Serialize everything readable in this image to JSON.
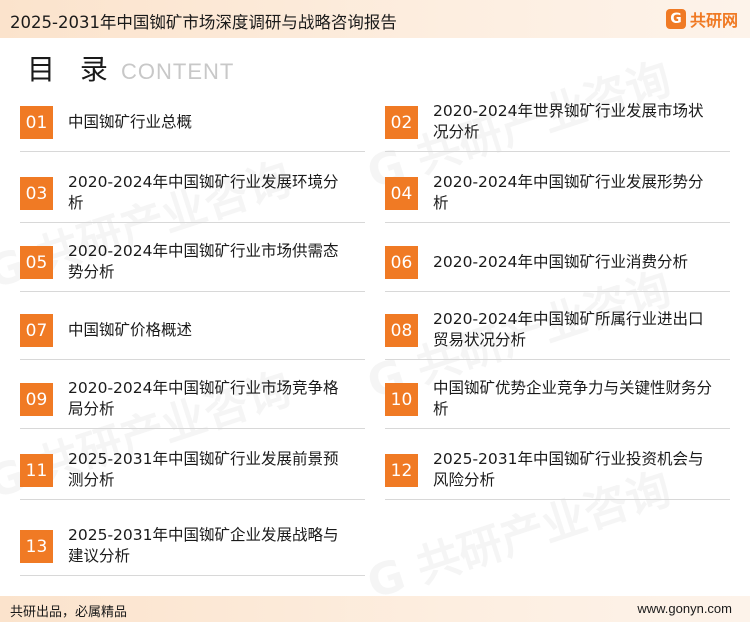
{
  "header": {
    "title": "2025-2031年中国铷矿市场深度调研与战略咨询报告",
    "logo_text": "共研网",
    "logo_mark": "G"
  },
  "toc": {
    "title_cn": "目 录",
    "title_en": "CONTENT",
    "items": [
      {
        "num": "01",
        "label": "中国铷矿行业总概"
      },
      {
        "num": "02",
        "label": "2020-2024年世界铷矿行业发展市场状况分析"
      },
      {
        "num": "03",
        "label": "2020-2024年中国铷矿行业发展环境分析"
      },
      {
        "num": "04",
        "label": "2020-2024年中国铷矿行业发展形势分析"
      },
      {
        "num": "05",
        "label": "2020-2024年中国铷矿行业市场供需态势分析"
      },
      {
        "num": "06",
        "label": "2020-2024年中国铷矿行业消费分析"
      },
      {
        "num": "07",
        "label": "中国铷矿价格概述"
      },
      {
        "num": "08",
        "label": "2020-2024年中国铷矿所属行业进出口贸易状况分析"
      },
      {
        "num": "09",
        "label": "2020-2024年中国铷矿行业市场竞争格局分析"
      },
      {
        "num": "10",
        "label": "中国铷矿优势企业竞争力与关键性财务分析"
      },
      {
        "num": "11",
        "label": "2025-2031年中国铷矿行业发展前景预测分析"
      },
      {
        "num": "12",
        "label": "2025-2031年中国铷矿行业投资机会与风险分析"
      },
      {
        "num": "13",
        "label": "2025-2031年中国铷矿企业发展战略与建议分析"
      }
    ]
  },
  "footer": {
    "left": "共研出品，必属精品",
    "right": "www.gonyn.com"
  },
  "colors": {
    "accent": "#f07a24",
    "header_bg": "#fbe3cc"
  }
}
